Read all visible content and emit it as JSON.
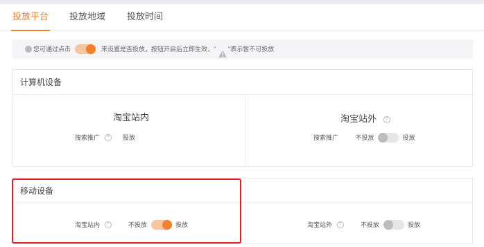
{
  "tabs": [
    {
      "label": "投放平台",
      "active": true
    },
    {
      "label": "投放地域",
      "active": false
    },
    {
      "label": "投放时间",
      "active": false
    }
  ],
  "notice": {
    "prefix": "您可通过点击",
    "middle": "来设置是否投放，按钮开启后立即生效，\"",
    "suffix": "\"表示暂不可投放"
  },
  "computer": {
    "title": "计算机设备",
    "inside": {
      "heading": "淘宝站内",
      "row_label": "搜索推广",
      "on_label": "投放"
    },
    "outside": {
      "heading": "淘宝站外",
      "row_label": "搜索推广",
      "off_label": "不投放",
      "on_label": "投放",
      "toggle_on": false
    }
  },
  "mobile": {
    "title": "移动设备",
    "inside": {
      "row_label": "淘宝站内",
      "off_label": "不投放",
      "on_label": "投放",
      "toggle_on": true
    },
    "outside": {
      "row_label": "淘宝站外",
      "off_label": "不投放",
      "on_label": "投放",
      "toggle_on": false
    }
  },
  "colors": {
    "accent": "#f2802d",
    "highlight": "#e02020"
  }
}
